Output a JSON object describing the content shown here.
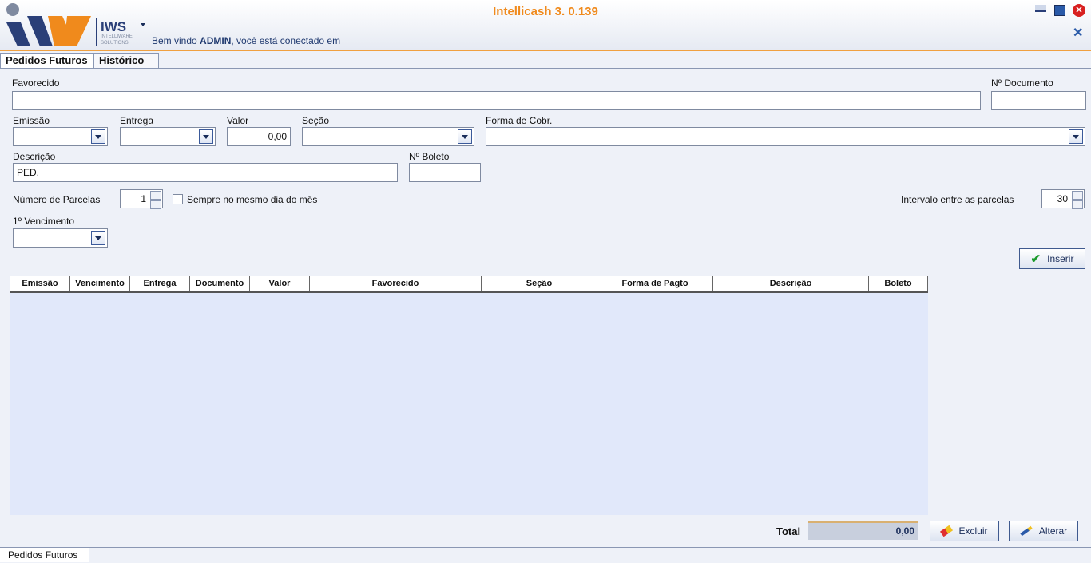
{
  "window": {
    "title": "Intellicash 3. 0.139",
    "brand_short": "IWS",
    "brand_line1": "INTELLIWARE",
    "brand_line2": "SOLUTIONS",
    "welcome_prefix": "Bem vindo ",
    "welcome_user": "ADMIN",
    "welcome_suffix": ", você está conectado em"
  },
  "tabs": [
    {
      "label": "Pedidos Futuros",
      "active": true
    },
    {
      "label": "Histórico",
      "active": false
    }
  ],
  "form": {
    "favorecido_label": "Favorecido",
    "favorecido_value": "",
    "documento_label": "Nº Documento",
    "documento_value": "",
    "emissao_label": "Emissão",
    "entrega_label": "Entrega",
    "valor_label": "Valor",
    "valor_value": "0,00",
    "secao_label": "Seção",
    "forma_cobr_label": "Forma de Cobr.",
    "descricao_label": "Descrição",
    "descricao_value": "PED.",
    "boleto_label": "Nº Boleto",
    "boleto_value": "",
    "parcelas_label": "Número de Parcelas",
    "parcelas_value": "1",
    "mesmo_dia_label": "Sempre no mesmo dia do mês",
    "intervalo_label": "Intervalo entre as parcelas",
    "intervalo_value": "30",
    "vencimento_label": "1º Vencimento",
    "inserir_label": "Inserir"
  },
  "grid": {
    "columns": [
      "Emissão",
      "Vencimento",
      "Entrega",
      "Documento",
      "Valor",
      "Favorecido",
      "Seção",
      "Forma de Pagto",
      "Descrição",
      "Boleto"
    ]
  },
  "footer": {
    "total_label": "Total",
    "total_value": "0,00",
    "excluir_label": "Excluir",
    "alterar_label": "Alterar"
  },
  "statusbar": {
    "tab_label": "Pedidos Futuros"
  },
  "colors": {
    "title": "#f08a1c",
    "accent_blue": "#1a2d5a",
    "grid_bg": "#e1e8fa"
  }
}
